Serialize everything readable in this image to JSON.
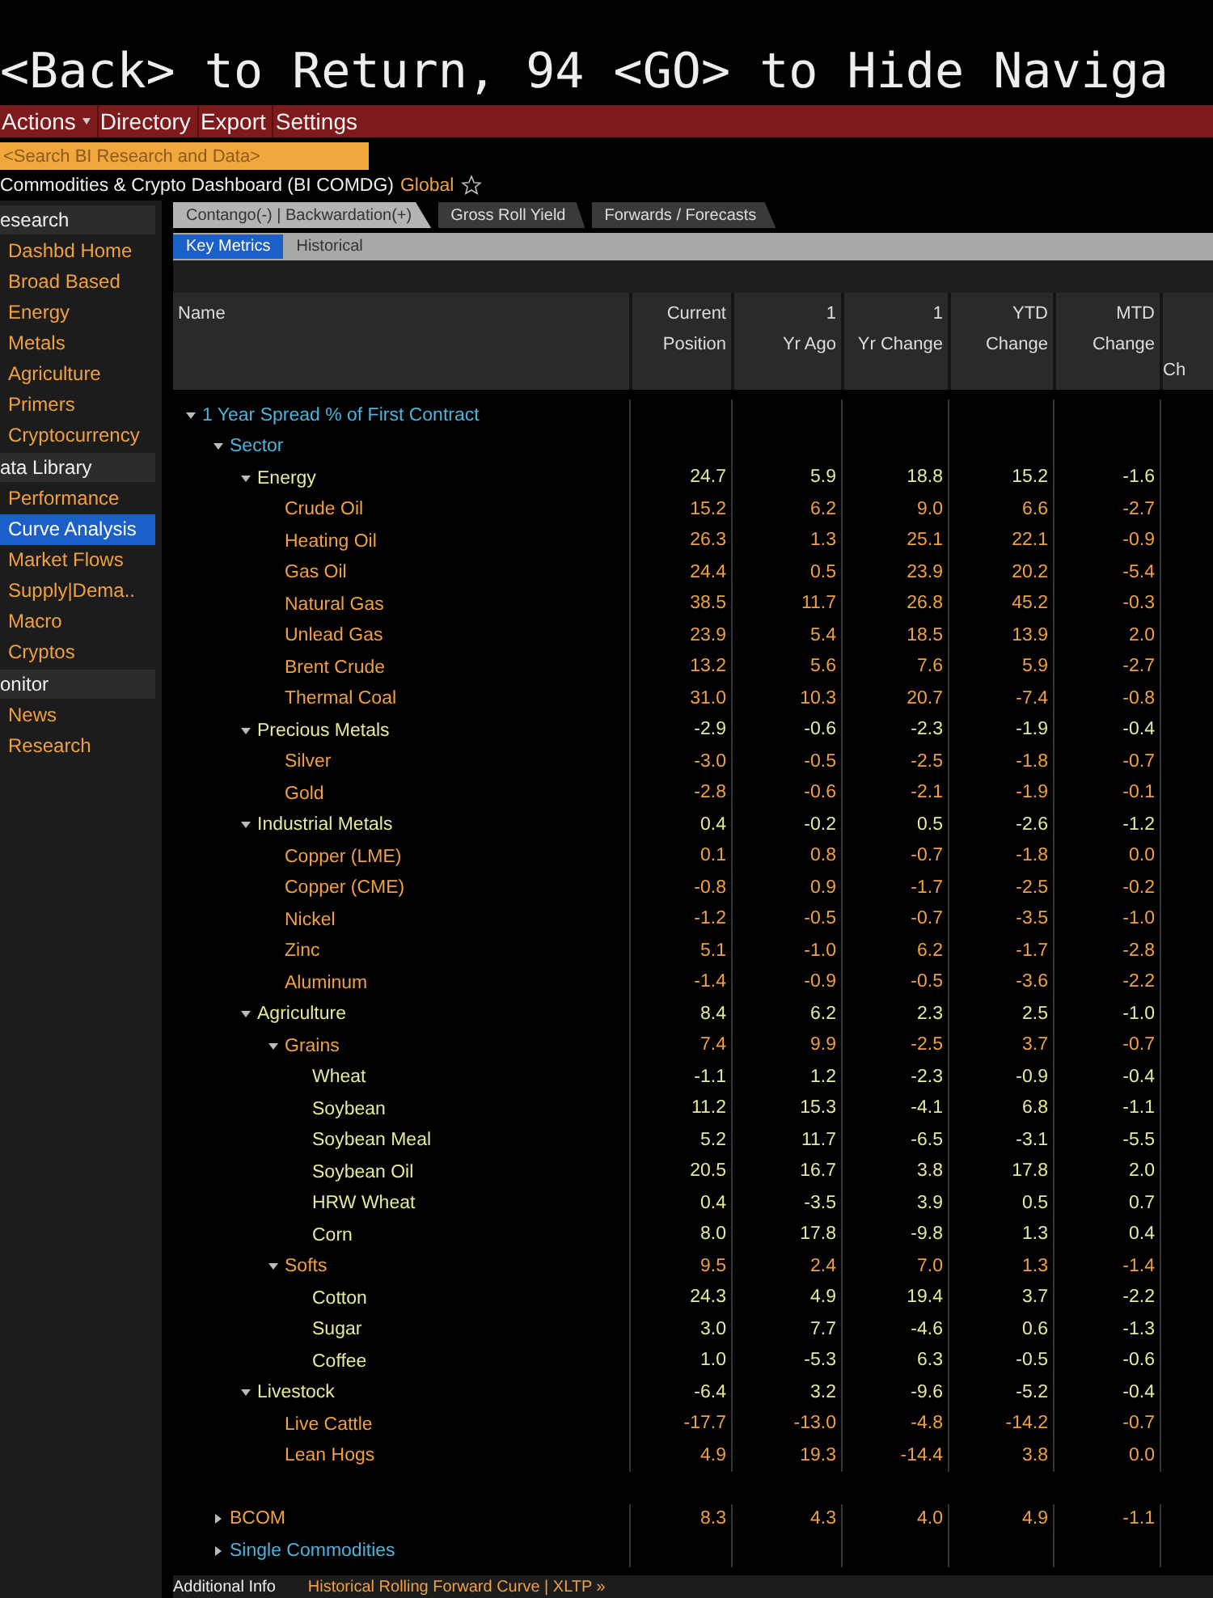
{
  "banner": "<Back> to Return, 94 <GO> to Hide Naviga",
  "menu": [
    {
      "label": "Actions",
      "dropdown": true
    },
    {
      "label": "Directory",
      "dropdown": false
    },
    {
      "label": "Export",
      "dropdown": false
    },
    {
      "label": "Settings",
      "dropdown": false
    }
  ],
  "search": {
    "placeholder": "<Search BI Research and Data>"
  },
  "dashboard": {
    "title": "Commodities & Crypto Dashboard (BI COMDG)",
    "scope": "Global",
    "favorite": false
  },
  "sidebar": [
    {
      "kind": "header",
      "label": "esearch"
    },
    {
      "kind": "item",
      "label": "Dashbd Home",
      "selected": false
    },
    {
      "kind": "item",
      "label": "Broad Based",
      "selected": false
    },
    {
      "kind": "item",
      "label": "Energy",
      "selected": false
    },
    {
      "kind": "item",
      "label": "Metals",
      "selected": false
    },
    {
      "kind": "item",
      "label": "Agriculture",
      "selected": false
    },
    {
      "kind": "item",
      "label": "Primers",
      "selected": false
    },
    {
      "kind": "item",
      "label": "Cryptocurrency",
      "selected": false
    },
    {
      "kind": "header",
      "label": "ata Library"
    },
    {
      "kind": "item",
      "label": "Performance",
      "selected": false
    },
    {
      "kind": "item",
      "label": "Curve Analysis",
      "selected": true
    },
    {
      "kind": "item",
      "label": "Market Flows",
      "selected": false
    },
    {
      "kind": "item",
      "label": "Supply|Dema..",
      "selected": false
    },
    {
      "kind": "item",
      "label": "Macro",
      "selected": false
    },
    {
      "kind": "item",
      "label": "Cryptos",
      "selected": false
    },
    {
      "kind": "header",
      "label": "onitor"
    },
    {
      "kind": "item",
      "label": "News",
      "selected": false
    },
    {
      "kind": "item",
      "label": "Research",
      "selected": false
    }
  ],
  "tabs": [
    {
      "label": "Contango(-) | Backwardation(+)",
      "selected": true
    },
    {
      "label": "Gross Roll Yield",
      "selected": false
    },
    {
      "label": "Forwards / Forecasts",
      "selected": false
    }
  ],
  "subtabs": [
    {
      "label": "Key Metrics",
      "selected": true
    },
    {
      "label": "Historical",
      "selected": false
    }
  ],
  "table": {
    "columns": [
      {
        "lines": [
          "Name"
        ]
      },
      {
        "lines": [
          "Current",
          "Position"
        ]
      },
      {
        "lines": [
          "1",
          "Yr Ago"
        ]
      },
      {
        "lines": [
          "1",
          "Yr Change"
        ]
      },
      {
        "lines": [
          "YTD",
          "Change"
        ]
      },
      {
        "lines": [
          "MTD",
          "Change"
        ]
      },
      {
        "lines": [
          "Ch"
        ]
      }
    ],
    "rows": [
      {
        "name": "1 Year Spread % of First Contract",
        "color": "#4ab4dc",
        "expanded": true,
        "children": [
          {
            "name": "Sector",
            "color": "#4ab4dc",
            "expanded": true,
            "children": [
              {
                "name": "Energy",
                "color": "#e6e89a",
                "expanded": true,
                "values": [
                  "24.7",
                  "5.9",
                  "18.8",
                  "15.2",
                  "-1.6"
                ],
                "children": [
                  {
                    "name": "Crude Oil",
                    "color": "#f0a040",
                    "values": [
                      "15.2",
                      "6.2",
                      "9.0",
                      "6.6",
                      "-2.7"
                    ]
                  },
                  {
                    "name": "Heating Oil",
                    "color": "#f0a040",
                    "values": [
                      "26.3",
                      "1.3",
                      "25.1",
                      "22.1",
                      "-0.9"
                    ]
                  },
                  {
                    "name": "Gas Oil",
                    "color": "#f0a040",
                    "values": [
                      "24.4",
                      "0.5",
                      "23.9",
                      "20.2",
                      "-5.4"
                    ]
                  },
                  {
                    "name": "Natural Gas",
                    "color": "#f0a040",
                    "values": [
                      "38.5",
                      "11.7",
                      "26.8",
                      "45.2",
                      "-0.3"
                    ]
                  },
                  {
                    "name": "Unlead Gas",
                    "color": "#f0a040",
                    "values": [
                      "23.9",
                      "5.4",
                      "18.5",
                      "13.9",
                      "2.0"
                    ]
                  },
                  {
                    "name": "Brent Crude",
                    "color": "#f0a040",
                    "values": [
                      "13.2",
                      "5.6",
                      "7.6",
                      "5.9",
                      "-2.7"
                    ]
                  },
                  {
                    "name": "Thermal Coal",
                    "color": "#f0a040",
                    "values": [
                      "31.0",
                      "10.3",
                      "20.7",
                      "-7.4",
                      "-0.8"
                    ]
                  }
                ]
              },
              {
                "name": "Precious Metals",
                "color": "#e6e89a",
                "expanded": true,
                "values": [
                  "-2.9",
                  "-0.6",
                  "-2.3",
                  "-1.9",
                  "-0.4"
                ],
                "children": [
                  {
                    "name": "Silver",
                    "color": "#f0a040",
                    "values": [
                      "-3.0",
                      "-0.5",
                      "-2.5",
                      "-1.8",
                      "-0.7"
                    ]
                  },
                  {
                    "name": "Gold",
                    "color": "#f0a040",
                    "values": [
                      "-2.8",
                      "-0.6",
                      "-2.1",
                      "-1.9",
                      "-0.1"
                    ]
                  }
                ]
              },
              {
                "name": "Industrial Metals",
                "color": "#e6e89a",
                "expanded": true,
                "values": [
                  "0.4",
                  "-0.2",
                  "0.5",
                  "-2.6",
                  "-1.2"
                ],
                "children": [
                  {
                    "name": "Copper (LME)",
                    "color": "#f0a040",
                    "values": [
                      "0.1",
                      "0.8",
                      "-0.7",
                      "-1.8",
                      "0.0"
                    ]
                  },
                  {
                    "name": "Copper (CME)",
                    "color": "#f0a040",
                    "values": [
                      "-0.8",
                      "0.9",
                      "-1.7",
                      "-2.5",
                      "-0.2"
                    ]
                  },
                  {
                    "name": "Nickel",
                    "color": "#f0a040",
                    "values": [
                      "-1.2",
                      "-0.5",
                      "-0.7",
                      "-3.5",
                      "-1.0"
                    ]
                  },
                  {
                    "name": "Zinc",
                    "color": "#f0a040",
                    "values": [
                      "5.1",
                      "-1.0",
                      "6.2",
                      "-1.7",
                      "-2.8"
                    ]
                  },
                  {
                    "name": "Aluminum",
                    "color": "#f0a040",
                    "values": [
                      "-1.4",
                      "-0.9",
                      "-0.5",
                      "-3.6",
                      "-2.2"
                    ]
                  }
                ]
              },
              {
                "name": "Agriculture",
                "color": "#e6e89a",
                "expanded": true,
                "values": [
                  "8.4",
                  "6.2",
                  "2.3",
                  "2.5",
                  "-1.0"
                ],
                "children": [
                  {
                    "name": "Grains",
                    "color": "#f0a040",
                    "expanded": true,
                    "values": [
                      "7.4",
                      "9.9",
                      "-2.5",
                      "3.7",
                      "-0.7"
                    ],
                    "children": [
                      {
                        "name": "Wheat",
                        "color": "#e6e89a",
                        "values": [
                          "-1.1",
                          "1.2",
                          "-2.3",
                          "-0.9",
                          "-0.4"
                        ]
                      },
                      {
                        "name": "Soybean",
                        "color": "#e6e89a",
                        "values": [
                          "11.2",
                          "15.3",
                          "-4.1",
                          "6.8",
                          "-1.1"
                        ]
                      },
                      {
                        "name": "Soybean Meal",
                        "color": "#e6e89a",
                        "values": [
                          "5.2",
                          "11.7",
                          "-6.5",
                          "-3.1",
                          "-5.5"
                        ]
                      },
                      {
                        "name": "Soybean Oil",
                        "color": "#e6e89a",
                        "values": [
                          "20.5",
                          "16.7",
                          "3.8",
                          "17.8",
                          "2.0"
                        ]
                      },
                      {
                        "name": "HRW Wheat",
                        "color": "#e6e89a",
                        "values": [
                          "0.4",
                          "-3.5",
                          "3.9",
                          "0.5",
                          "0.7"
                        ]
                      },
                      {
                        "name": "Corn",
                        "color": "#e6e89a",
                        "values": [
                          "8.0",
                          "17.8",
                          "-9.8",
                          "1.3",
                          "0.4"
                        ]
                      }
                    ]
                  },
                  {
                    "name": "Softs",
                    "color": "#f0a040",
                    "expanded": true,
                    "values": [
                      "9.5",
                      "2.4",
                      "7.0",
                      "1.3",
                      "-1.4"
                    ],
                    "children": [
                      {
                        "name": "Cotton",
                        "color": "#e6e89a",
                        "values": [
                          "24.3",
                          "4.9",
                          "19.4",
                          "3.7",
                          "-2.2"
                        ]
                      },
                      {
                        "name": "Sugar",
                        "color": "#e6e89a",
                        "values": [
                          "3.0",
                          "7.7",
                          "-4.6",
                          "0.6",
                          "-1.3"
                        ]
                      },
                      {
                        "name": "Coffee",
                        "color": "#e6e89a",
                        "values": [
                          "1.0",
                          "-5.3",
                          "6.3",
                          "-0.5",
                          "-0.6"
                        ]
                      }
                    ]
                  }
                ]
              },
              {
                "name": "Livestock",
                "color": "#e6e89a",
                "expanded": true,
                "values": [
                  "-6.4",
                  "3.2",
                  "-9.6",
                  "-5.2",
                  "-0.4"
                ],
                "children": [
                  {
                    "name": "Live Cattle",
                    "color": "#f0a040",
                    "values": [
                      "-17.7",
                      "-13.0",
                      "-4.8",
                      "-14.2",
                      "-0.7"
                    ]
                  },
                  {
                    "name": "Lean Hogs",
                    "color": "#f0a040",
                    "values": [
                      "4.9",
                      "19.3",
                      "-14.4",
                      "3.8",
                      "0.0"
                    ]
                  }
                ]
              }
            ]
          },
          {
            "name": "BCOM",
            "color": "#f0a040",
            "expanded": false,
            "values": [
              "8.3",
              "4.3",
              "4.0",
              "4.9",
              "-1.1"
            ]
          },
          {
            "name": "Single Commodities",
            "color": "#4ab4dc",
            "expanded": false
          }
        ]
      }
    ]
  },
  "footer": {
    "label": "Additional Info",
    "link": "Historical Rolling Forward Curve | XLTP »"
  }
}
